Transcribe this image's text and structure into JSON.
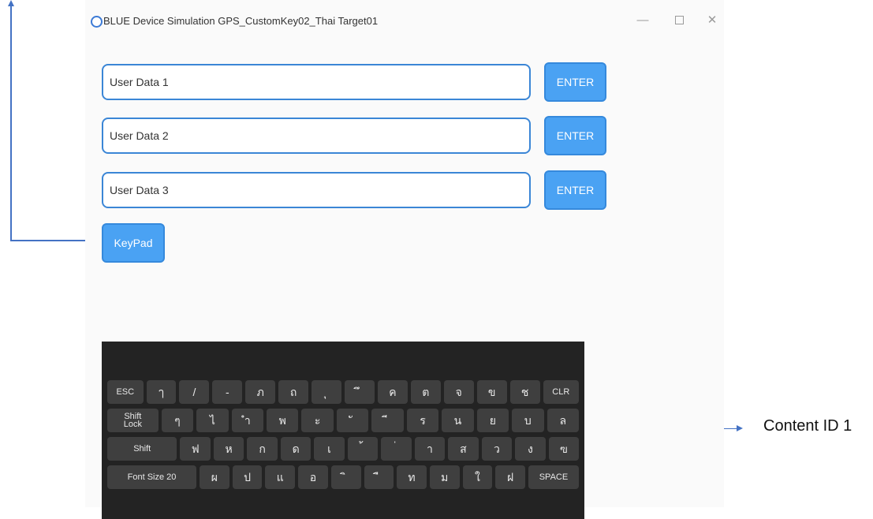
{
  "window": {
    "title": "BLUE Device Simulation GPS_CustomKey02_Thai Target01",
    "controls": {
      "minimize": "—",
      "close": "✕"
    }
  },
  "inputs": [
    {
      "placeholder": "User Data 1",
      "button": "ENTER"
    },
    {
      "placeholder": "User Data 2",
      "button": "ENTER"
    },
    {
      "placeholder": "User Data 3",
      "button": "ENTER"
    }
  ],
  "keypad_button": "KeyPad",
  "keyboard": {
    "rows": [
      [
        "ESC",
        "ๅ",
        "/",
        "-",
        "ภ",
        "ถ",
        "ุ",
        "ึ",
        "ค",
        "ต",
        "จ",
        "ข",
        "ช",
        "CLR"
      ],
      [
        "Shift\nLock",
        "ๆ",
        "ไ",
        "ำ",
        "พ",
        "ะ",
        "ั",
        "ี",
        "ร",
        "น",
        "ย",
        "บ",
        "ล"
      ],
      [
        "Shift",
        "ฟ",
        "ห",
        "ก",
        "ด",
        "เ",
        "้",
        "่",
        "า",
        "ส",
        "ว",
        "ง",
        "ฃ"
      ],
      [
        "Font Size 20",
        "ผ",
        "ป",
        "แ",
        "อ",
        "ิ",
        "ื",
        "ท",
        "ม",
        "ใ",
        "ฝ",
        "SPACE"
      ]
    ]
  },
  "annotation": {
    "label": "Content ID 1",
    "color": "#4472c4"
  },
  "colors": {
    "accent": "#4aa2f3",
    "field_border": "#3b86d6",
    "keyboard_bg": "#232323",
    "key_bg": "#3f3f3f"
  }
}
